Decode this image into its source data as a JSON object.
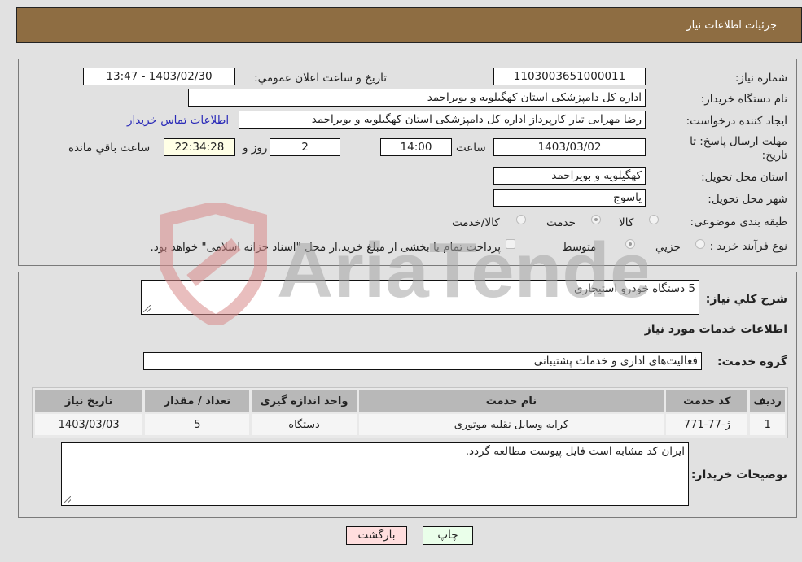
{
  "header": {
    "title": "جزئیات اطلاعات نیاز"
  },
  "details": {
    "need_number": {
      "label": "شماره نیاز:",
      "value": "1103003651000011"
    },
    "announce_datetime": {
      "label": "تاریخ و ساعت اعلان عمومي:",
      "value": "1403/02/30 - 13:47"
    },
    "buyer_org": {
      "label": "نام دستگاه خریدار:",
      "value": "اداره کل دامپزشکی استان کهگیلویه و بویراحمد"
    },
    "requester": {
      "label": "ایجاد کننده درخواست:",
      "value": "رضا مهرابی تبار کارپرداز اداره کل دامپزشکی استان کهگیلویه و بویراحمد",
      "contact_link": "اطلاعات تماس خریدار"
    },
    "deadline": {
      "label_line1": "مهلت ارسال پاسخ: تا",
      "label_line2": "تاریخ:",
      "date": "1403/03/02",
      "time_label": "ساعت",
      "time": "14:00",
      "days": "2",
      "days_label": "روز و",
      "remaining": "22:34:28",
      "remaining_label": "ساعت باقي مانده"
    },
    "delivery_province": {
      "label": "استان محل تحویل:",
      "value": "کهگیلویه و بویراحمد"
    },
    "delivery_city": {
      "label": "شهر محل تحویل:",
      "value": "یاسوج"
    },
    "category": {
      "label": "طبقه بندی موضوعی:",
      "options": [
        "کالا",
        "خدمت",
        "کالا/خدمت"
      ],
      "selected": "خدمت"
    },
    "purchase_process": {
      "label": "نوع فرآیند خرید :",
      "options": [
        "جزيي",
        "متوسط"
      ],
      "selected": "متوسط",
      "treasury_note": "پرداخت تمام یا بخشی از مبلغ خرید،از محل \"اسناد خزانه اسلامی\" خواهد بود."
    }
  },
  "summary": {
    "general_desc_label": "شرح کلي نیاز:",
    "general_desc": "5 دستگاه خودرو استیجاری",
    "services_heading": "اطلاعات خدمات مورد نیاز",
    "service_group_label": "گروه خدمت:",
    "service_group": "فعالیت‌های اداری و خدمات پشتیبانی"
  },
  "table": {
    "headers": [
      "ردیف",
      "کد خدمت",
      "نام خدمت",
      "واحد اندازه گیری",
      "تعداد / مقدار",
      "تاریخ نیاز"
    ],
    "rows": [
      [
        "1",
        "ژ-77-771",
        "کرایه وسایل نقلیه موتوری",
        "دستگاه",
        "5",
        "1403/03/03"
      ]
    ]
  },
  "buyer_notes": {
    "label": "توضیحات خریدار:",
    "value": "ایران کد مشابه است فایل پیوست مطالعه گردد."
  },
  "buttons": {
    "print": "چاپ",
    "back": "بازگشت"
  },
  "colors": {
    "header_bg": "#8e6d42",
    "print_bg": "#eaffea",
    "back_bg": "#ffdede",
    "remaining_bg": "#ffffe6",
    "link": "#2a2ab8"
  },
  "watermark": {
    "text": "AriaTender.neT"
  }
}
